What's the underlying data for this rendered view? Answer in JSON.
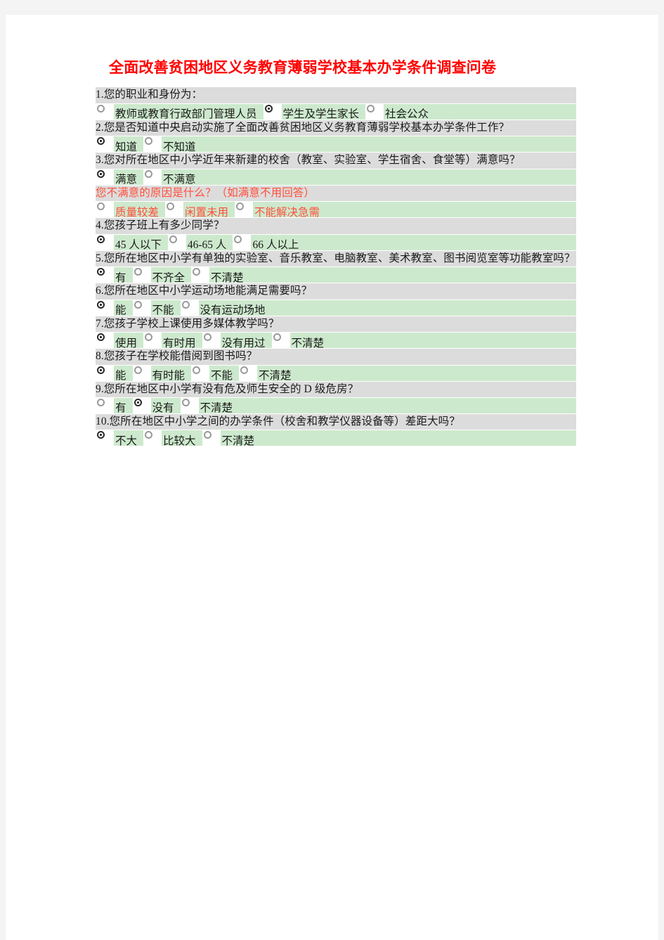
{
  "document": {
    "title": "全面改善贫困地区义务教育薄弱学校基本办学条件调查问卷",
    "title_color": "#ff0000",
    "accent_red": "#ff4f3a",
    "question_row_color": "#dcdcdc",
    "answer_row_color": "#cde9cd",
    "page_background": "#f4f4f4",
    "sheet_background": "#ffffff"
  },
  "blocks": [
    {
      "id": "q1",
      "question": "1.您的职业和身份为：",
      "red": false,
      "options": [
        {
          "label": "教师或教育行政部门管理人员",
          "checked": false
        },
        {
          "label": "学生及学生家长",
          "checked": true
        },
        {
          "label": "社会公众",
          "checked": false
        }
      ]
    },
    {
      "id": "q2",
      "question": "2.您是否知道中央启动实施了全面改善贫困地区义务教育薄弱学校基本办学条件工作？",
      "red": false,
      "options": [
        {
          "label": "知道",
          "checked": true
        },
        {
          "label": "不知道",
          "checked": false
        }
      ]
    },
    {
      "id": "q3",
      "question": "3.您对所在地区中小学近年来新建的校舍（教室、实验室、学生宿舍、食堂等）满意吗？",
      "red": false,
      "options": [
        {
          "label": "满意",
          "checked": true
        },
        {
          "label": "不满意",
          "checked": false
        }
      ]
    },
    {
      "id": "q3b",
      "question": "您不满意的原因是什么？（如满意不用回答）",
      "red": true,
      "options": [
        {
          "label": "质量较差",
          "checked": false
        },
        {
          "label": "闲置未用",
          "checked": false
        },
        {
          "label": "不能解决急需",
          "checked": false
        }
      ]
    },
    {
      "id": "q4",
      "question": "4.您孩子班上有多少同学？",
      "red": false,
      "options": [
        {
          "label": "45 人以下",
          "checked": true
        },
        {
          "label": "46-65 人",
          "checked": false
        },
        {
          "label": "66 人以上",
          "checked": false
        }
      ]
    },
    {
      "id": "q5",
      "question": "5.您所在地区中小学有单独的实验室、音乐教室、电脑教室、美术教室、图书阅览室等功能教室吗？",
      "red": false,
      "options": [
        {
          "label": "有",
          "checked": true
        },
        {
          "label": "不齐全",
          "checked": false
        },
        {
          "label": "不清楚",
          "checked": false
        }
      ]
    },
    {
      "id": "q6",
      "question": "6.您所在地区中小学运动场地能满足需要吗？",
      "red": false,
      "options": [
        {
          "label": "能",
          "checked": true
        },
        {
          "label": "不能",
          "checked": false
        },
        {
          "label": "没有运动场地",
          "checked": false
        }
      ]
    },
    {
      "id": "q7",
      "question": "7.您孩子学校上课使用多媒体教学吗？",
      "red": false,
      "options": [
        {
          "label": "使用",
          "checked": true
        },
        {
          "label": "有时用",
          "checked": false
        },
        {
          "label": "没有用过",
          "checked": false
        },
        {
          "label": "不清楚",
          "checked": false
        }
      ]
    },
    {
      "id": "q8",
      "question": "8.您孩子在学校能借阅到图书吗？",
      "red": false,
      "options": [
        {
          "label": "能",
          "checked": true
        },
        {
          "label": "有时能",
          "checked": false
        },
        {
          "label": "不能",
          "checked": false
        },
        {
          "label": "不清楚",
          "checked": false
        }
      ]
    },
    {
      "id": "q9",
      "question": "9.您所在地区中小学有没有危及师生安全的 D 级危房？",
      "red": false,
      "options": [
        {
          "label": "有",
          "checked": false
        },
        {
          "label": "没有",
          "checked": true
        },
        {
          "label": "不清楚",
          "checked": false
        }
      ]
    },
    {
      "id": "q10",
      "question": "10.您所在地区中小学之间的办学条件（校舍和教学仪器设备等）差距大吗？",
      "red": false,
      "options": [
        {
          "label": "不大",
          "checked": true
        },
        {
          "label": "比较大",
          "checked": false
        },
        {
          "label": "不清楚",
          "checked": false
        }
      ]
    }
  ]
}
